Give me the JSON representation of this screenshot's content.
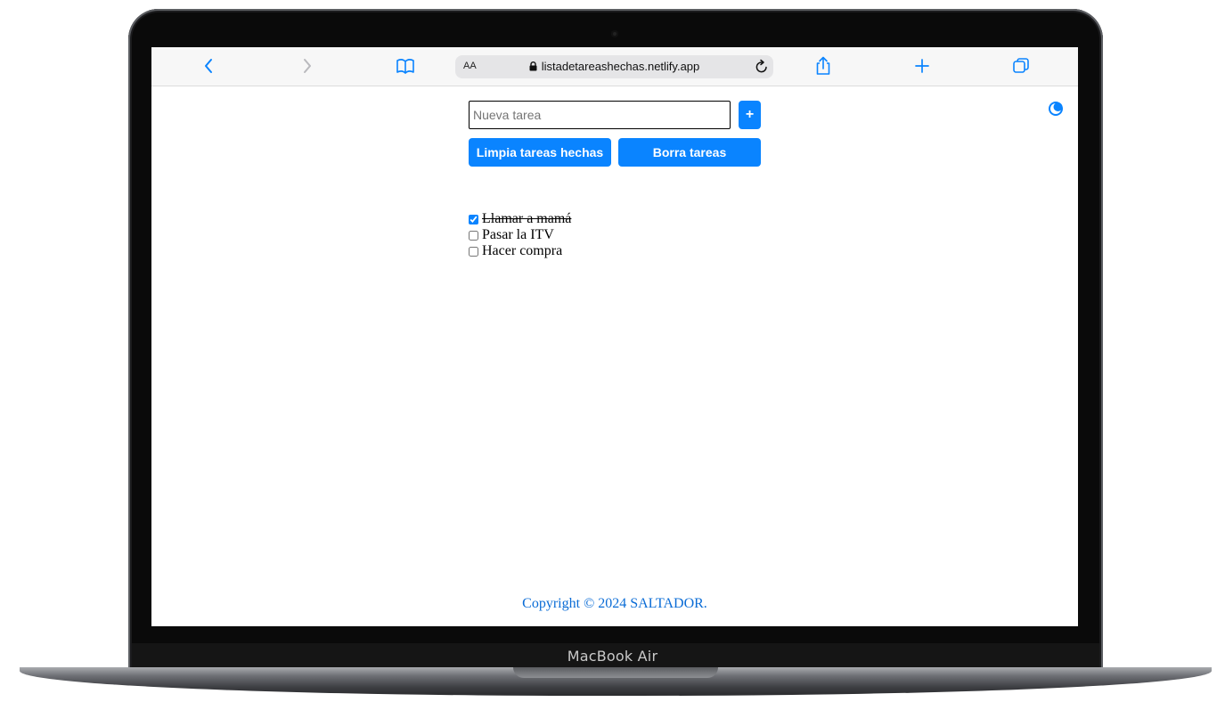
{
  "device": {
    "label": "MacBook Air"
  },
  "browser": {
    "text_size_label": "AA",
    "url": "listadetareashechas.netlify.app",
    "accent_color": "#0a84ff",
    "icons": [
      "chevron-left-icon",
      "chevron-right-icon",
      "book-icon",
      "lock-icon",
      "reload-icon",
      "share-icon",
      "plus-icon",
      "tabs-icon"
    ]
  },
  "app": {
    "input": {
      "placeholder": "Nueva tarea",
      "value": ""
    },
    "add_label": "+",
    "clear_done_label": "Limpia tareas hechas",
    "delete_all_label": "Borra tareas",
    "theme_icon": "moon-icon",
    "tasks": [
      {
        "label": "Llamar a mamá",
        "done": true
      },
      {
        "label": "Pasar la ITV",
        "done": false
      },
      {
        "label": "Hacer compra",
        "done": false
      }
    ],
    "footer": "Copyright © 2024 SALTADOR."
  }
}
